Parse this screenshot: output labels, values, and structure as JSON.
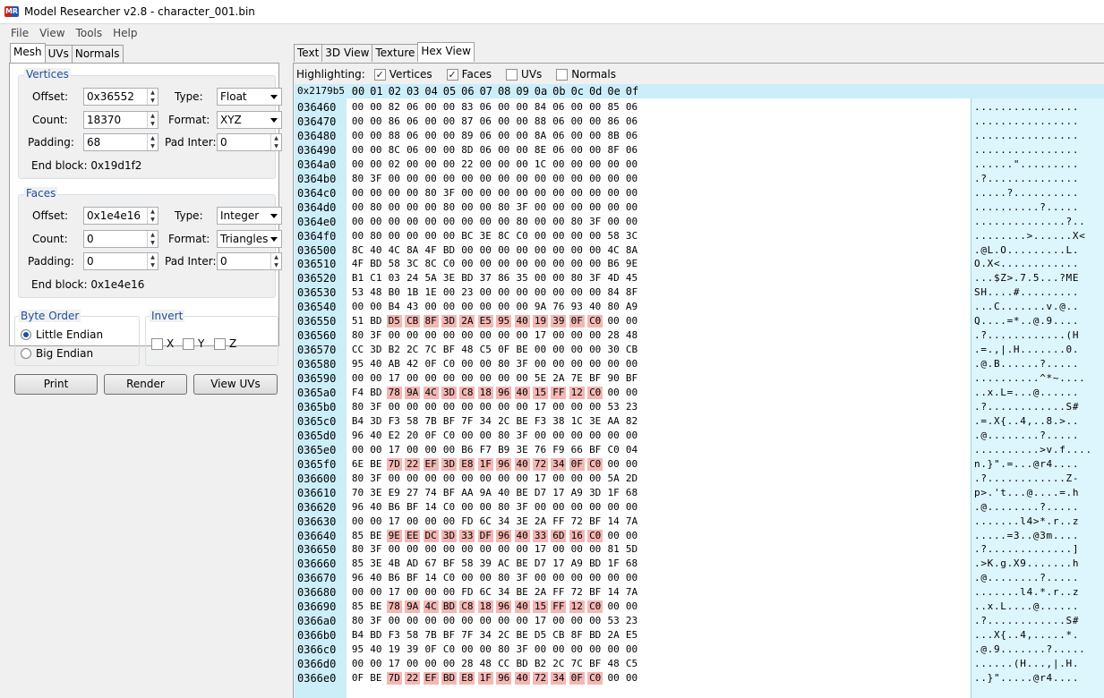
{
  "window": {
    "title": "Model Researcher v2.8 - character_001.bin",
    "icon": "MR"
  },
  "menu": [
    "File",
    "View",
    "Tools",
    "Help"
  ],
  "left_tabs": [
    "Mesh",
    "UVs",
    "Normals"
  ],
  "vertices": {
    "title": "Vertices",
    "offset_label": "Offset:",
    "offset": "0x36552",
    "count_label": "Count:",
    "count": "18370",
    "padding_label": "Padding:",
    "padding": "68",
    "type_label": "Type:",
    "type": "Float",
    "format_label": "Format:",
    "format": "XYZ",
    "padinter_label": "Pad Inter:",
    "padinter": "0",
    "endblock": "End block: 0x19d1f2"
  },
  "faces": {
    "title": "Faces",
    "offset_label": "Offset:",
    "offset": "0x1e4e16",
    "count_label": "Count:",
    "count": "0",
    "padding_label": "Padding:",
    "padding": "0",
    "type_label": "Type:",
    "type": "Integer",
    "format_label": "Format:",
    "format": "Triangles",
    "padinter_label": "Pad Inter:",
    "padinter": "0",
    "endblock": "End block: 0x1e4e16"
  },
  "byte_order": {
    "title": "Byte Order",
    "little": "Little Endian",
    "big": "Big Endian"
  },
  "invert": {
    "title": "Invert",
    "x": "X",
    "y": "Y",
    "z": "Z"
  },
  "buttons": {
    "print": "Print",
    "render": "Render",
    "view_uvs": "View UVs"
  },
  "right_tabs": [
    "Text",
    "3D View",
    "Texture",
    "Hex View"
  ],
  "highlighting": {
    "label": "Highlighting:",
    "vertices": "Vertices",
    "faces": "Faces",
    "uvs": "UVs",
    "normals": "Normals"
  },
  "hex": {
    "offset": "0x2179b5",
    "columns": [
      "00",
      "01",
      "02",
      "03",
      "04",
      "05",
      "06",
      "07",
      "08",
      "09",
      "0a",
      "0b",
      "0c",
      "0d",
      "0e",
      "0f"
    ],
    "rows": [
      {
        "addr": "036460",
        "bytes": "00 00 82 06 00 00 83 06 00 00 84 06 00 00 85 06",
        "ascii": "................"
      },
      {
        "addr": "036470",
        "bytes": "00 00 86 06 00 00 87 06 00 00 88 06 00 00 86 06",
        "ascii": "................"
      },
      {
        "addr": "036480",
        "bytes": "00 00 88 06 00 00 89 06 00 00 8A 06 00 00 8B 06",
        "ascii": "................"
      },
      {
        "addr": "036490",
        "bytes": "00 00 8C 06 00 00 8D 06 00 00 8E 06 00 00 8F 06",
        "ascii": "................"
      },
      {
        "addr": "0364a0",
        "bytes": "00 00 02 00 00 00 22 00 00 00 1C 00 00 00 00 00",
        "ascii": "......\"........."
      },
      {
        "addr": "0364b0",
        "bytes": "80 3F 00 00 00 00 00 00 00 00 00 00 00 00 00 00",
        "ascii": ".?.............."
      },
      {
        "addr": "0364c0",
        "bytes": "00 00 00 00 80 3F 00 00 00 00 00 00 00 00 00 00",
        "ascii": ".....?.........."
      },
      {
        "addr": "0364d0",
        "bytes": "00 80 00 00 00 80 00 00 80 3F 00 00 00 00 00 00",
        "ascii": "..........?....."
      },
      {
        "addr": "0364e0",
        "bytes": "00 00 00 00 00 00 00 00 00 80 00 00 80 3F 00 00",
        "ascii": "..............?.."
      },
      {
        "addr": "0364f0",
        "bytes": "00 80 00 00 00 00 BC 3E 8C C0 00 00 00 00 58 3C",
        "ascii": "........>......X<"
      },
      {
        "addr": "036500",
        "bytes": "8C 40 4C 8A 4F BD 00 00 00 00 00 00 00 00 4C 8A",
        "ascii": ".@L.O.........L."
      },
      {
        "addr": "036510",
        "bytes": "4F BD 58 3C 8C C0 00 00 00 00 00 00 00 00 B6 9E",
        "ascii": "O.X<............"
      },
      {
        "addr": "036520",
        "bytes": "B1 C1 03 24 5A 3E BD 37 86 35 00 00 80 3F 4D 45",
        "ascii": "...$Z>.7.5...?ME"
      },
      {
        "addr": "036530",
        "bytes": "53 48 B0 1B 1E 00 23 00 00 00 00 00 00 00 84 8F",
        "ascii": "SH....#........."
      },
      {
        "addr": "036540",
        "bytes": "00 00 B4 43 00 00 00 00 00 00 9A 76 93 40 80 A9",
        "ascii": "...C.......v.@.."
      },
      {
        "addr": "036550",
        "bytes": "51 BD D5 CB 8F 3D 2A E5 95 40 19 39 0F C0 00 00",
        "ascii": "Q....=*..@.9....",
        "hl": [
          2,
          3,
          4,
          5,
          6,
          7,
          8,
          9,
          10,
          11,
          12,
          13
        ]
      },
      {
        "addr": "036560",
        "bytes": "80 3F 00 00 00 00 00 00 00 00 17 00 00 00 28 48",
        "ascii": ".?............(H"
      },
      {
        "addr": "036570",
        "bytes": "CC 3D B2 2C 7C BF 48 C5 0F BE 00 00 00 00 30 CB",
        "ascii": ".=.,|.H.......0."
      },
      {
        "addr": "036580",
        "bytes": "95 40 AB 42 0F C0 00 00 80 3F 00 00 00 00 00 00",
        "ascii": ".@.B......?....."
      },
      {
        "addr": "036590",
        "bytes": "00 00 17 00 00 00 00 00 00 00 5E 2A 7E BF 90 BF",
        "ascii": "..........^*~...."
      },
      {
        "addr": "0365a0",
        "bytes": "F4 BD 78 9A 4C 3D C8 18 96 40 15 FF 12 C0 00 00",
        "ascii": "..x.L=...@......",
        "hl": [
          2,
          3,
          4,
          5,
          6,
          7,
          8,
          9,
          10,
          11,
          12,
          13
        ]
      },
      {
        "addr": "0365b0",
        "bytes": "80 3F 00 00 00 00 00 00 00 00 17 00 00 00 53 23",
        "ascii": ".?............S#"
      },
      {
        "addr": "0365c0",
        "bytes": "B4 3D F3 58 7B BF 7F 34 2C BE F3 38 1C 3E AA 82",
        "ascii": ".=.X{..4,..8.>.."
      },
      {
        "addr": "0365d0",
        "bytes": "96 40 E2 20 0F C0 00 00 80 3F 00 00 00 00 00 00",
        "ascii": ".@........?....."
      },
      {
        "addr": "0365e0",
        "bytes": "00 00 17 00 00 00 B6 F7 B9 3E 76 F9 66 BF C0 04",
        "ascii": "..........>v.f...."
      },
      {
        "addr": "0365f0",
        "bytes": "6E BE 7D 22 EF 3D E8 1F 96 40 72 34 0F C0 00 00",
        "ascii": "n.}\".=...@r4....",
        "hl": [
          2,
          3,
          4,
          5,
          6,
          7,
          8,
          9,
          10,
          11,
          12,
          13
        ]
      },
      {
        "addr": "036600",
        "bytes": "80 3F 00 00 00 00 00 00 00 00 17 00 00 00 5A 2D",
        "ascii": ".?............Z-"
      },
      {
        "addr": "036610",
        "bytes": "70 3E E9 27 74 BF AA 9A 40 BE D7 17 A9 3D 1F 68",
        "ascii": "p>.'t...@....=.h"
      },
      {
        "addr": "036620",
        "bytes": "96 40 B6 BF 14 C0 00 00 80 3F 00 00 00 00 00 00",
        "ascii": ".@........?....."
      },
      {
        "addr": "036630",
        "bytes": "00 00 17 00 00 00 FD 6C 34 3E 2A FF 72 BF 14 7A",
        "ascii": ".......l4>*.r..z"
      },
      {
        "addr": "036640",
        "bytes": "85 BE 9E EE DC 3D 33 DF 96 40 33 6D 16 C0 00 00",
        "ascii": ".....=3..@3m....",
        "hl": [
          2,
          3,
          4,
          5,
          6,
          7,
          8,
          9,
          10,
          11,
          12,
          13
        ]
      },
      {
        "addr": "036650",
        "bytes": "80 3F 00 00 00 00 00 00 00 00 17 00 00 00 81 5D",
        "ascii": ".?.............]"
      },
      {
        "addr": "036660",
        "bytes": "85 3E 4B AD 67 BF 58 39 AC BE D7 17 A9 BD 1F 68",
        "ascii": ".>K.g.X9.......h"
      },
      {
        "addr": "036670",
        "bytes": "96 40 B6 BF 14 C0 00 00 80 3F 00 00 00 00 00 00",
        "ascii": ".@........?....."
      },
      {
        "addr": "036680",
        "bytes": "00 00 17 00 00 00 FD 6C 34 BE 2A FF 72 BF 14 7A",
        "ascii": ".......l4.*.r..z"
      },
      {
        "addr": "036690",
        "bytes": "85 BE 78 9A 4C BD C8 18 96 40 15 FF 12 C0 00 00",
        "ascii": "..x.L....@......",
        "hl": [
          2,
          3,
          4,
          5,
          6,
          7,
          8,
          9,
          10,
          11,
          12,
          13
        ]
      },
      {
        "addr": "0366a0",
        "bytes": "80 3F 00 00 00 00 00 00 00 00 17 00 00 00 53 23",
        "ascii": ".?............S#"
      },
      {
        "addr": "0366b0",
        "bytes": "B4 BD F3 58 7B BF 7F 34 2C BE D5 CB 8F BD 2A E5",
        "ascii": "...X{..4,.....*."
      },
      {
        "addr": "0366c0",
        "bytes": "95 40 19 39 0F C0 00 00 80 3F 00 00 00 00 00 00",
        "ascii": ".@.9.......?....."
      },
      {
        "addr": "0366d0",
        "bytes": "00 00 17 00 00 00 28 48 CC BD B2 2C 7C BF 48 C5",
        "ascii": "......(H...,|.H."
      },
      {
        "addr": "0366e0",
        "bytes": "0F BE 7D 22 EF BD E8 1F 96 40 72 34 0F C0 00 00",
        "ascii": "..}\".....@r4....",
        "hl": [
          2,
          3,
          4,
          5,
          6,
          7,
          8,
          9,
          10,
          11,
          12,
          13
        ]
      }
    ]
  },
  "colors": {
    "highlight": "#f4b7b2",
    "hex_header": "#cceef8",
    "group_title": "#1f4e9c"
  }
}
